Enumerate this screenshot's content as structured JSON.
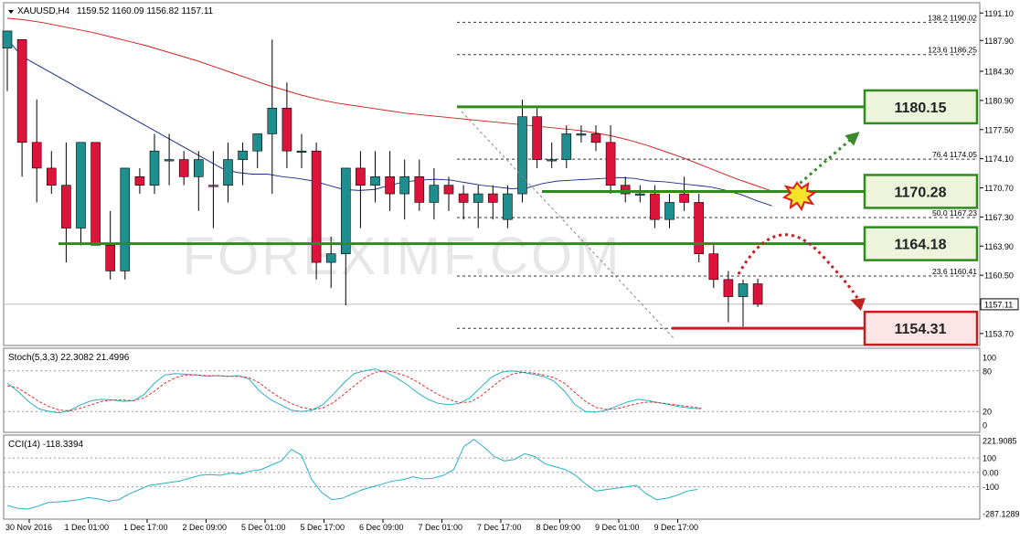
{
  "header": {
    "symbol": "XAUUSD,H4",
    "ohlc": "1159.52 1160.09 1156.82 1157.11"
  },
  "watermark": "FOREXIMF.COM",
  "chart_data": [
    {
      "type": "candlestick",
      "panel": "price",
      "ylim": [
        1152.3,
        1192.3
      ],
      "price_ticks": [
        1191.1,
        1187.9,
        1184.3,
        1180.9,
        1177.5,
        1174.1,
        1170.7,
        1167.3,
        1163.9,
        1160.5,
        1157.11,
        1153.7
      ],
      "current_price": "1157.11",
      "x_labels": [
        "30 Nov 2016",
        "1 Dec 01:00",
        "1 Dec 17:00",
        "2 Dec 09:00",
        "5 Dec 01:00",
        "5 Dec 17:00",
        "6 Dec 09:00",
        "7 Dec 01:00",
        "7 Dec 17:00",
        "8 Dec 09:00",
        "9 Dec 01:00",
        "9 Dec 17:00"
      ],
      "candles": [
        [
          1187.0,
          1189.0,
          1182.0,
          1189.0
        ],
        [
          1188.0,
          1188.0,
          1172.0,
          1176.0
        ],
        [
          1176.0,
          1181.0,
          1169.0,
          1173.0
        ],
        [
          1173.0,
          1175.0,
          1170.0,
          1171.0
        ],
        [
          1171.0,
          1176.0,
          1162.0,
          1166.0
        ],
        [
          1166.0,
          1176.0,
          1164.0,
          1176.0
        ],
        [
          1176.0,
          1176.0,
          1164.0,
          1164.0
        ],
        [
          1164.0,
          1168.0,
          1160.0,
          1161.0
        ],
        [
          1161.0,
          1173.0,
          1160.0,
          1173.0
        ],
        [
          1172.0,
          1173.0,
          1170.0,
          1171.0
        ],
        [
          1171.0,
          1177.0,
          1170.0,
          1175.0
        ],
        [
          1174.0,
          1177.0,
          1171.0,
          1174.0
        ],
        [
          1174.0,
          1175.0,
          1171.0,
          1172.0
        ],
        [
          1172.0,
          1175.0,
          1168.0,
          1174.0
        ],
        [
          1171.0,
          1175.0,
          1166.0,
          1171.0
        ],
        [
          1171.0,
          1176.0,
          1169.0,
          1174.0
        ],
        [
          1174.0,
          1176.0,
          1171.0,
          1175.0
        ],
        [
          1175.0,
          1177.0,
          1173.0,
          1177.0
        ],
        [
          1177.0,
          1188.0,
          1170.0,
          1180.0
        ],
        [
          1180.0,
          1183.0,
          1173.0,
          1175.0
        ],
        [
          1175.0,
          1177.0,
          1173.0,
          1175.0
        ],
        [
          1175.0,
          1176.0,
          1160.0,
          1162.0
        ],
        [
          1162.0,
          1165.0,
          1159.0,
          1163.0
        ],
        [
          1163.0,
          1173.0,
          1157.0,
          1173.0
        ],
        [
          1173.0,
          1175.0,
          1166.0,
          1171.0
        ],
        [
          1171.0,
          1175.0,
          1169.0,
          1172.0
        ],
        [
          1172.0,
          1175.0,
          1168.0,
          1170.0
        ],
        [
          1170.0,
          1174.0,
          1167.0,
          1172.0
        ],
        [
          1172.0,
          1174.0,
          1168.0,
          1169.0
        ],
        [
          1169.0,
          1173.0,
          1167.0,
          1171.0
        ],
        [
          1171.0,
          1172.0,
          1168.0,
          1170.0
        ],
        [
          1170.0,
          1171.0,
          1167.0,
          1169.0
        ],
        [
          1169.0,
          1171.0,
          1166.0,
          1170.0
        ],
        [
          1170.0,
          1171.0,
          1167.0,
          1169.0
        ],
        [
          1167.0,
          1171.0,
          1166.0,
          1170.0
        ],
        [
          1170.0,
          1181.0,
          1169.0,
          1179.0
        ],
        [
          1179.0,
          1180.0,
          1173.0,
          1174.0
        ],
        [
          1174.0,
          1176.0,
          1173.0,
          1174.0
        ],
        [
          1174.0,
          1178.0,
          1173.0,
          1177.0
        ],
        [
          1177.0,
          1178.0,
          1176.0,
          1177.0
        ],
        [
          1177.0,
          1178.0,
          1175.0,
          1176.0
        ],
        [
          1176.0,
          1178.0,
          1170.0,
          1171.0
        ],
        [
          1171.0,
          1172.0,
          1169.0,
          1170.0
        ],
        [
          1170.0,
          1171.0,
          1169.0,
          1170.0
        ],
        [
          1170.0,
          1171.0,
          1166.0,
          1167.0
        ],
        [
          1167.0,
          1170.0,
          1166.0,
          1169.0
        ],
        [
          1170.0,
          1172.0,
          1168.0,
          1169.0
        ],
        [
          1169.0,
          1170.0,
          1162.0,
          1163.0
        ],
        [
          1163.0,
          1164.0,
          1159.0,
          1160.0
        ],
        [
          1160.0,
          1161.0,
          1155.0,
          1158.0
        ],
        [
          1158.0,
          1160.0,
          1154.5,
          1159.5
        ],
        [
          1159.5,
          1160.1,
          1156.8,
          1157.11
        ]
      ],
      "ma_fast": [
        1188.0,
        1186.0,
        1185.0,
        1184.0,
        1183.0,
        1182.0,
        1181.0,
        1180.0,
        1179.0,
        1178.0,
        1177.0,
        1176.0,
        1175.0,
        1174.0,
        1173.0,
        1172.5,
        1172.3,
        1172.3,
        1172.0,
        1171.8,
        1171.5,
        1171.0,
        1170.5,
        1170.4,
        1170.5,
        1171.0,
        1171.4,
        1171.6,
        1171.7,
        1171.6,
        1171.3,
        1171.0,
        1170.8,
        1170.6,
        1170.7,
        1171.2,
        1171.5,
        1171.6,
        1171.7,
        1171.8,
        1171.9,
        1171.8,
        1171.5,
        1171.4,
        1171.2,
        1171.0,
        1170.8,
        1170.4,
        1169.9,
        1169.2,
        1168.6
      ],
      "ma_slow": [
        1190.5,
        1190.3,
        1190.0,
        1189.6,
        1189.2,
        1188.8,
        1188.3,
        1187.8,
        1187.3,
        1186.7,
        1186.1,
        1185.5,
        1184.8,
        1184.1,
        1183.4,
        1182.7,
        1182.1,
        1181.5,
        1181.0,
        1180.6,
        1180.3,
        1180.0,
        1179.7,
        1179.4,
        1179.2,
        1179.0,
        1178.8,
        1178.6,
        1178.4,
        1178.2,
        1178.0,
        1177.8,
        1177.6,
        1177.4,
        1177.1,
        1176.7,
        1176.2,
        1175.6,
        1174.9,
        1174.2,
        1173.4,
        1172.6,
        1171.8,
        1171.1,
        1170.4
      ],
      "fib_levels": [
        {
          "label": "138.2  1190.02",
          "price": 1190.02
        },
        {
          "label": "123.6  1186.25",
          "price": 1186.25
        },
        {
          "label": "76.4  1174.05",
          "price": 1174.05
        },
        {
          "label": "50.0  1167.23",
          "price": 1167.23
        },
        {
          "label": "23.6  1160.41",
          "price": 1160.41
        },
        {
          "label": "",
          "price": 1154.3
        }
      ],
      "levels": [
        {
          "value": "1180.15",
          "price": 1180.15,
          "color": "#2e8b1c"
        },
        {
          "value": "1170.28",
          "price": 1170.28,
          "color": "#2e8b1c"
        },
        {
          "value": "1164.18",
          "price": 1164.18,
          "color": "#2e8b1c"
        },
        {
          "value": "1154.31",
          "price": 1154.31,
          "color": "#c02020"
        }
      ],
      "colors": {
        "bull": "#1e8e8e",
        "bear": "#dc143c",
        "ma_fast": "#1c2f8a",
        "ma_slow": "#d02020",
        "grid": "#c8c8c8"
      }
    },
    {
      "type": "line",
      "panel": "stochastic",
      "title": "Stoch(5,3,3) 22.3082 21.4996",
      "ylim": [
        0,
        100
      ],
      "ticks": [
        "100",
        "80",
        "20",
        "0"
      ],
      "series": [
        {
          "values": [
            62,
            50,
            35,
            24,
            20,
            18,
            22,
            30,
            36,
            38,
            37,
            35,
            36,
            45,
            62,
            74,
            76,
            75,
            74,
            72,
            73,
            72,
            73,
            68,
            50,
            38,
            30,
            22,
            20,
            22,
            30,
            45,
            62,
            76,
            80,
            83,
            78,
            70,
            60,
            48,
            38,
            32,
            30,
            32,
            40,
            55,
            70,
            78,
            80,
            78,
            75,
            72,
            65,
            50,
            30,
            20,
            19,
            22,
            28,
            34,
            38,
            36,
            33,
            30,
            27,
            25,
            24
          ]
        },
        {
          "values": [
            58,
            55,
            45,
            35,
            27,
            22,
            21,
            25,
            30,
            35,
            37,
            37,
            36,
            40,
            50,
            62,
            70,
            74,
            74,
            73,
            73,
            72,
            72,
            70,
            62,
            50,
            40,
            32,
            26,
            23,
            25,
            33,
            45,
            58,
            70,
            78,
            80,
            77,
            72,
            64,
            54,
            45,
            38,
            33,
            34,
            42,
            55,
            67,
            75,
            78,
            77,
            74,
            70,
            62,
            48,
            35,
            26,
            23,
            24,
            28,
            32,
            34,
            33,
            31,
            29,
            27,
            25
          ]
        }
      ]
    },
    {
      "type": "line",
      "panel": "cci",
      "title": "CCI(14) -118.3394",
      "ylim": [
        -287.1289,
        221.9085
      ],
      "ticks": [
        "221.9085",
        "100",
        "0.00",
        "-100",
        "-287.1289"
      ],
      "series": [
        {
          "values": [
            -230,
            -250,
            -255,
            -235,
            -210,
            -205,
            -200,
            -190,
            -175,
            -185,
            -200,
            -190,
            -150,
            -120,
            -90,
            -80,
            -70,
            -60,
            -40,
            -20,
            -15,
            -20,
            -5,
            -10,
            10,
            20,
            50,
            80,
            160,
            120,
            -50,
            -140,
            -190,
            -180,
            -150,
            -120,
            -100,
            -80,
            -60,
            -50,
            -30,
            -45,
            -40,
            -20,
            20,
            180,
            230,
            175,
            110,
            80,
            90,
            130,
            110,
            60,
            40,
            20,
            -20,
            -80,
            -130,
            -120,
            -110,
            -100,
            -90,
            -150,
            -190,
            -180,
            -160,
            -130,
            -118.3
          ]
        }
      ]
    }
  ]
}
